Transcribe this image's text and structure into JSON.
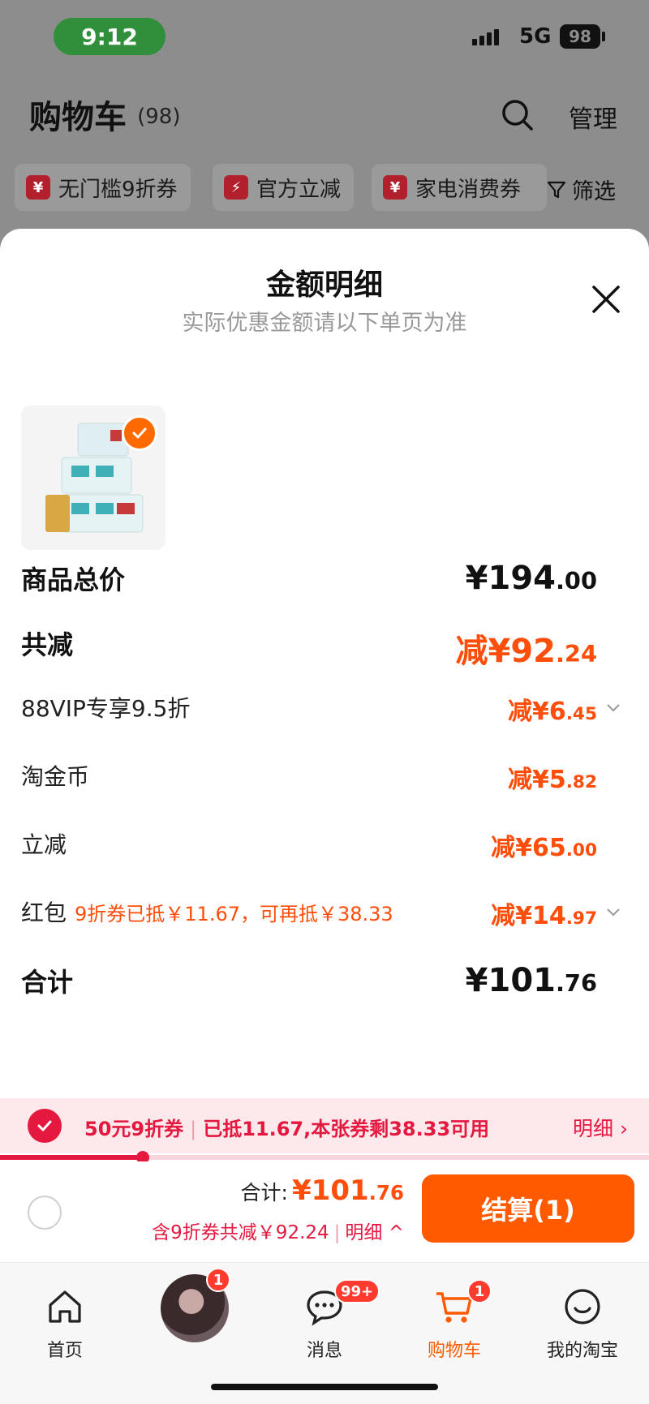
{
  "status_bar": {
    "time": "9:12",
    "network": "5G",
    "battery": "98"
  },
  "header": {
    "title": "购物车",
    "count": "(98)",
    "manage": "管理"
  },
  "chips": [
    {
      "icon": "¥",
      "label": "无门槛9折券"
    },
    {
      "icon": "⚡",
      "label": "官方立减"
    },
    {
      "icon": "¥",
      "label": "家电消费券"
    }
  ],
  "filter": {
    "label": "筛选"
  },
  "sheet": {
    "title": "金额明细",
    "subtitle": "实际优惠金额请以下单页为准"
  },
  "rows": {
    "subtotal": {
      "label": "商品总价",
      "value_main": "¥194",
      "value_dec": ".00"
    },
    "total_reduction": {
      "label": "共减",
      "value_main": "减¥92",
      "value_dec": ".24"
    },
    "vip": {
      "label": "88VIP专享9.5折",
      "value_main": "减¥6",
      "value_dec": ".45"
    },
    "coins": {
      "label": "淘金币",
      "value_main": "减¥5",
      "value_dec": ".82"
    },
    "instant": {
      "label": "立减",
      "value_main": "减¥65",
      "value_dec": ".00"
    },
    "redpacket": {
      "label": "红包",
      "note": "9折券已抵￥11.67，可再抵￥38.33",
      "value_main": "减¥14",
      "value_dec": ".97"
    },
    "total": {
      "label": "合计",
      "value_main": "¥101",
      "value_dec": ".76"
    }
  },
  "coupon_bar": {
    "coupon": "50元9折券",
    "message": "已抵11.67,本张券剩38.33可用",
    "detail": "明细 ›",
    "progress": 0.22
  },
  "checkout": {
    "total_label": "合计:",
    "total_main": "¥101",
    "total_dec": ".76",
    "discount": "含9折券共减￥92.24",
    "detail": "明细 ^",
    "pay_button": "结算(1)"
  },
  "tabbar": {
    "items": [
      {
        "label": "首页",
        "badge": ""
      },
      {
        "label": "",
        "badge": "1"
      },
      {
        "label": "消息",
        "badge": "99+"
      },
      {
        "label": "购物车",
        "badge": "1"
      },
      {
        "label": "我的淘宝",
        "badge": ""
      }
    ]
  },
  "colors": {
    "accent": "#ff5a00",
    "coupon": "#e5183f"
  }
}
